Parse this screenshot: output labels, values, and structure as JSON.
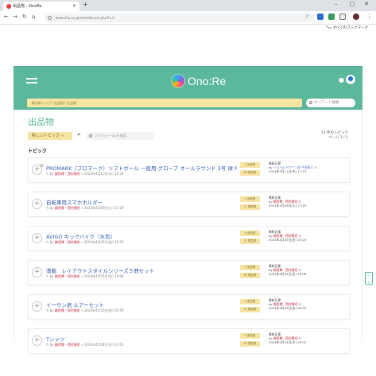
{
  "browser": {
    "tab_title": "出品物 - OnoRe",
    "url": "www.ohp.xx.jp/onore/forum.php?f=3",
    "bookmark_label": "すべてのブックマーク"
  },
  "header": {
    "logo_text": "Ono:Re"
  },
  "subheader": {
    "breadcrumb": "掲示板トップ / 出品物 / 出品物",
    "search_placeholder": "キーワード検索..."
  },
  "main": {
    "page_title": "出品物",
    "new_topic_label": "新しいトピック",
    "filter_placeholder": "このフォーラムを検索...",
    "topic_count": "12 件のトピック",
    "page_info": "ページ 1 / 1",
    "section_title": "トピック"
  },
  "topics": [
    {
      "title": "PROMARK（プロマーク）ソフトボール 一般用 グローブ オールラウンド 3号 球 PGS",
      "author": "森西博・西村周宏",
      "meta": "» 2024年4月10日(水) 15:24",
      "replies": "1 返信数",
      "views": "64 閲覧数",
      "last_label": "最新記事",
      "last_by": "システムデザイン部 今堀直人",
      "last_date": "2024年4月11日(木) 17:27",
      "badge": "0"
    },
    {
      "title": "自転車用スマホホルダー",
      "author": "森西博・西村周宏",
      "meta": "» 2024年4月09日(火) 17:29",
      "replies": "0 返信数",
      "views": "17 閲覧数",
      "last_label": "最新記事",
      "last_by": "森西博・西村周宏",
      "last_date": "2024年4月09日(火) 17:29",
      "badge": ""
    },
    {
      "title": "AVIGO キックバイク（水色）",
      "author": "森西博・西村周宏",
      "meta": "» 2024年4月05日(金) 10:20",
      "replies": "0 返信数",
      "views": "15 閲覧数",
      "last_label": "最新記事",
      "last_by": "森西博・西村周宏",
      "last_date": "2024年4月05日(金) 10:20",
      "badge": ""
    },
    {
      "title": "満載　レイアウトスタイルシリーズ５冊セット",
      "author": "森西博・西村周宏",
      "meta": "» 2024年4月05日(金) 10:08",
      "replies": "0 返信数",
      "views": "16 閲覧数",
      "last_label": "最新記事",
      "last_by": "森西博・西村周宏",
      "last_date": "2024年4月05日(金) 10:08",
      "badge": ""
    },
    {
      "title": "イーサン君 ルアーセット",
      "author": "森西博・西村周宏",
      "meta": "» 2024年4月05日(金) 09:59",
      "replies": "0 返信数",
      "views": "14 閲覧数",
      "last_label": "最新記事",
      "last_by": "森西博・西村周宏",
      "last_date": "2024年4月05日(金) 09:59",
      "badge": ""
    },
    {
      "title": "Tシャツ",
      "author": "森西博・西村周宏",
      "meta": "» 2024年4月04日(木) 23:02",
      "replies": "0 返信数",
      "views": "22 閲覧数",
      "last_label": "最新記事",
      "last_by": "森西博・西村周宏",
      "last_date": "2024年4月04日(木) 23:02",
      "badge": ""
    }
  ],
  "colors": {
    "brand": "#5cb89d",
    "highlight": "#f6e4a3",
    "link": "#3a64b8"
  }
}
